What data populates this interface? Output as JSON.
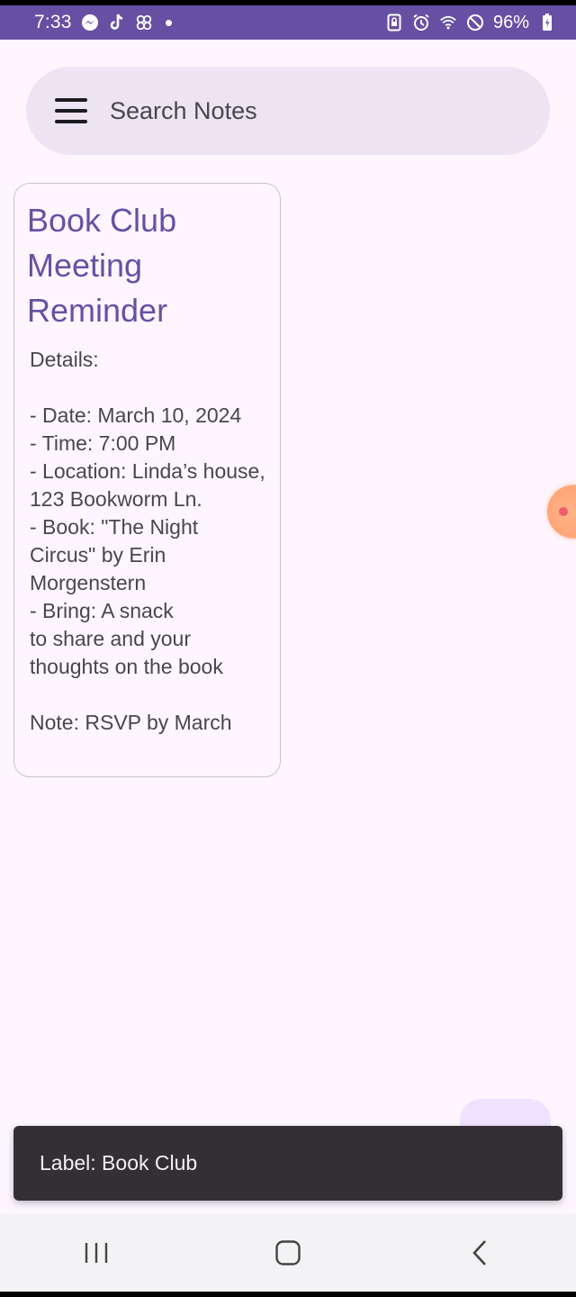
{
  "status_bar": {
    "time": "7:33",
    "battery": "96%",
    "left_icons": [
      "messenger-icon",
      "tiktok-icon",
      "pinwheel-icon",
      "dot-icon"
    ],
    "right_icons": [
      "sim-lock-icon",
      "alarm-icon",
      "wifi-icon",
      "do-not-disturb-icon",
      "battery-charging-icon"
    ]
  },
  "search": {
    "placeholder": "Search Notes"
  },
  "note": {
    "title": "Book Club Meeting Reminder",
    "body": "Details:\n\n- Date: March 10, 2024\n- Time: 7:00 PM\n- Location: Linda’s house, 123 Bookworm Ln.\n- Book: \"The Night Circus\" by Erin Morgenstern\n- Bring: A snack\nto share and your thoughts on the book\n\nNote: RSVP by March"
  },
  "snackbar": {
    "text": "Label: Book Club"
  },
  "colors": {
    "accent": "#6750a4",
    "background": "#fdf6fe",
    "search_bg": "#ece4f3",
    "snackbar_bg": "#322f35"
  }
}
